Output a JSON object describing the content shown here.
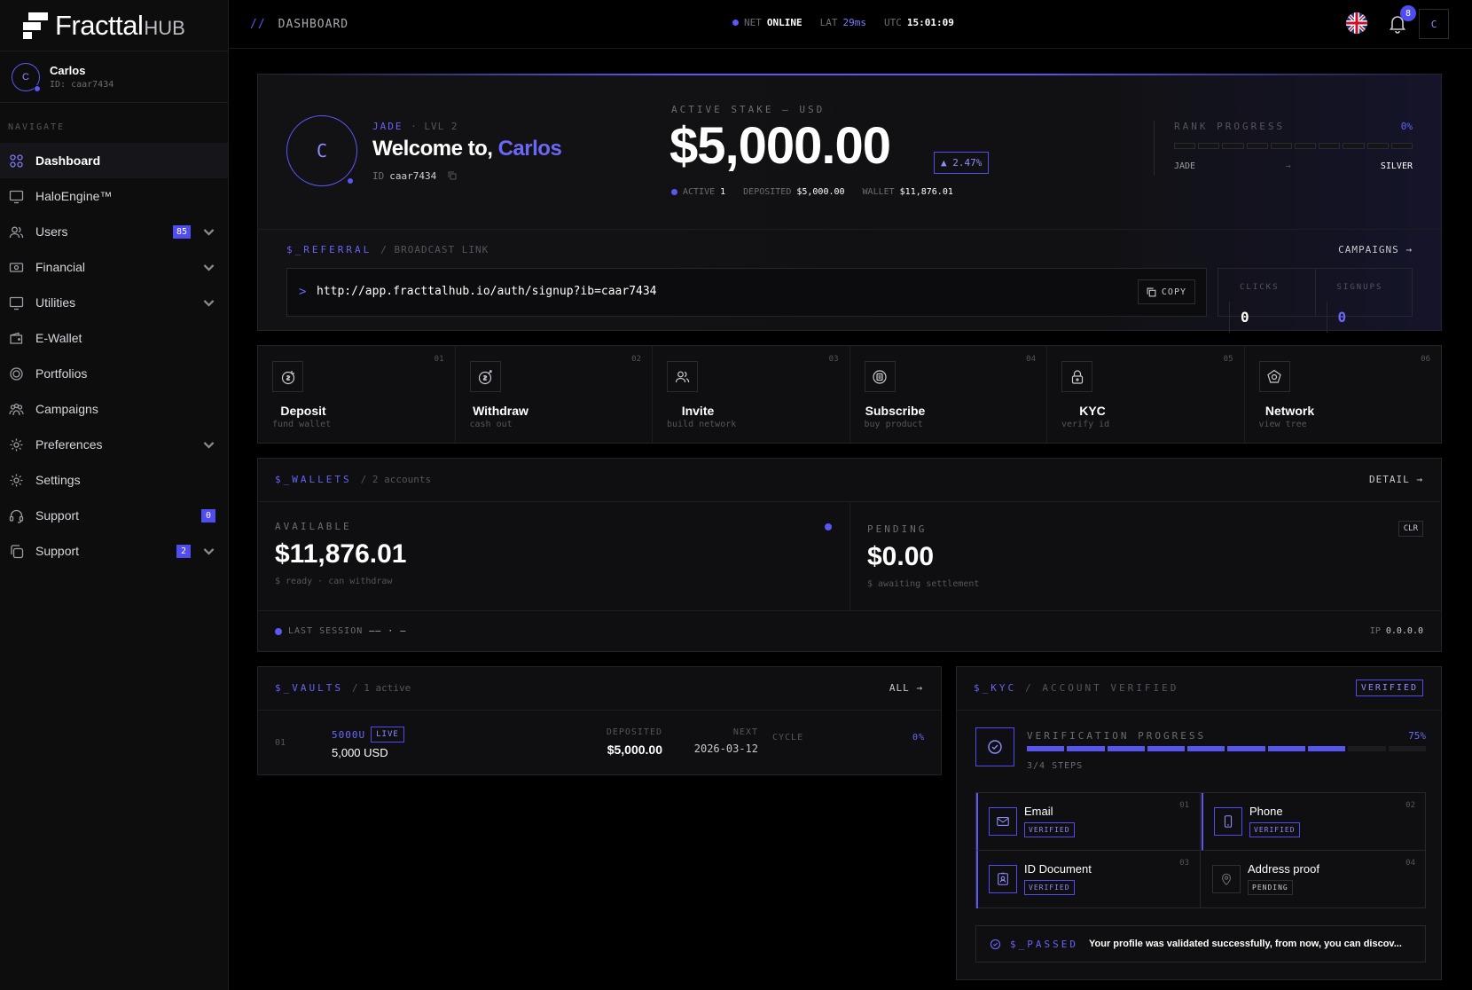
{
  "brand": {
    "name": "Fracttal",
    "suffix": "HUB"
  },
  "user": {
    "initial": "C",
    "name": "Carlos",
    "id": "ID: caar7434"
  },
  "nav": {
    "heading": "NAVIGATE",
    "items": [
      {
        "label": "Dashboard",
        "icon": "grid-icon",
        "active": true
      },
      {
        "label": "HaloEngine™",
        "icon": "monitor-icon"
      },
      {
        "label": "Users",
        "icon": "users-icon",
        "badge": "85",
        "chevron": true
      },
      {
        "label": "Financial",
        "icon": "cash-icon",
        "chevron": true
      },
      {
        "label": "Utilities",
        "icon": "monitor-icon",
        "chevron": true
      },
      {
        "label": "E-Wallet",
        "icon": "wallet-icon"
      },
      {
        "label": "Portfolios",
        "icon": "coin-icon"
      },
      {
        "label": "Campaigns",
        "icon": "people-icon"
      },
      {
        "label": "Preferences",
        "icon": "gear-icon",
        "chevron": true
      },
      {
        "label": "Settings",
        "icon": "gear-icon"
      },
      {
        "label": "Support",
        "icon": "headset-icon",
        "badge": "0"
      },
      {
        "label": "Support",
        "icon": "copy-icon",
        "badge": "2",
        "chevron": true
      }
    ]
  },
  "topbar": {
    "slashes": "//",
    "crumb": "DASHBOARD",
    "net_label": "NET",
    "net_value": "ONLINE",
    "lat_label": "LAT",
    "lat_value": "29ms",
    "utc_label": "UTC",
    "utc_value": "15:01:09",
    "notifications": "8",
    "avatar": "C"
  },
  "hero": {
    "avatar": "C",
    "tier": "JADE",
    "level": "· LVL 2",
    "welcome": "Welcome to, ",
    "name": "Carlos",
    "id_label": "ID",
    "id_value": "caar7434",
    "stake_label": "ACTIVE STAKE — USD",
    "stake": "$5,000.00",
    "delta": "▲ 2.47%",
    "active_label": "ACTIVE",
    "active_value": "1",
    "deposited_label": "DEPOSITED",
    "deposited_value": "$5,000.00",
    "wallet_label": "WALLET",
    "wallet_value": "$11,876.01",
    "rank_label": "RANK PROGRESS",
    "rank_percent": "0%",
    "rank_progress": 0,
    "rank_from": "JADE",
    "rank_arrow": "→",
    "rank_to": "SILVER",
    "referral_label": "$_REFERRAL",
    "referral_sub": "/ BROADCAST LINK",
    "campaigns": "CAMPAIGNS →",
    "prompt": ">",
    "url": "http://app.fracttalhub.io/auth/signup?ib=caar7434",
    "copy": "COPY",
    "clicks_label": "CLICKS",
    "clicks": "0",
    "signups_label": "SIGNUPS",
    "signups": "0"
  },
  "actions": [
    {
      "num": "01",
      "title": "Deposit",
      "sub": "fund wallet",
      "icon": "deposit-icon"
    },
    {
      "num": "02",
      "title": "Withdraw",
      "sub": "cash out",
      "icon": "withdraw-icon"
    },
    {
      "num": "03",
      "title": "Invite",
      "sub": "build network",
      "icon": "invite-icon"
    },
    {
      "num": "04",
      "title": "Subscribe",
      "sub": "buy product",
      "icon": "subscribe-icon"
    },
    {
      "num": "05",
      "title": "KYC",
      "sub": "verify id",
      "icon": "lock-icon"
    },
    {
      "num": "06",
      "title": "Network",
      "sub": "view tree",
      "icon": "network-icon"
    }
  ],
  "wallets": {
    "title": "$_WALLETS",
    "sub": "/ 2 accounts",
    "detail": "DETAIL →",
    "available_label": "AVAILABLE",
    "available": "$11,876.01",
    "available_sub": "$ ready · can withdraw",
    "pending_label": "PENDING",
    "pending": "$0.00",
    "pending_sub": "$ awaiting settlement",
    "clr": "CLR",
    "session_label": "LAST SESSION",
    "session_value": "—— · —",
    "ip_label": "IP",
    "ip_value": "0.0.0.0"
  },
  "vaults": {
    "title": "$_VAULTS",
    "sub": "/ 1 active",
    "all": "ALL →",
    "rows": [
      {
        "idx": "01",
        "name": "5000U",
        "status": "LIVE",
        "amount": "5,000 USD",
        "deposited_label": "DEPOSITED",
        "deposited": "$5,000.00",
        "next_label": "NEXT",
        "next": "2026-03-12",
        "cycle_label": "CYCLE",
        "cycle": "0%"
      }
    ]
  },
  "kyc": {
    "title": "$_KYC",
    "sub": "/ ACCOUNT VERIFIED",
    "badge": "VERIFIED",
    "progress_label": "VERIFICATION PROGRESS",
    "progress_percent": "75%",
    "progress": 0.75,
    "steps": "3/4 STEPS",
    "items": [
      {
        "num": "01",
        "name": "Email",
        "status": "VERIFIED",
        "icon": "mail-icon"
      },
      {
        "num": "02",
        "name": "Phone",
        "status": "VERIFIED",
        "icon": "phone-icon"
      },
      {
        "num": "03",
        "name": "ID Document",
        "status": "VERIFIED",
        "icon": "id-card-icon"
      },
      {
        "num": "04",
        "name": "Address proof",
        "status": "PENDING",
        "icon": "map-pin-icon"
      }
    ],
    "passed_label": "$_PASSED",
    "passed_msg": "Your profile was validated successfully, from now, you can discov..."
  },
  "colors": {
    "accent": "#5b57f5",
    "background": "#000000",
    "panel": "#0f0f11"
  }
}
